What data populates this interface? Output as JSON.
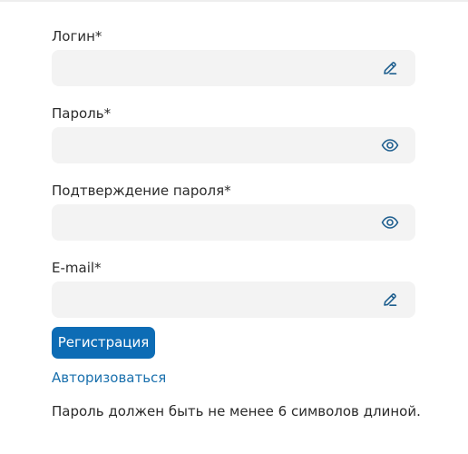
{
  "fields": [
    {
      "label": "Логин*",
      "value": "",
      "placeholder": "",
      "icon": "pencil-icon"
    },
    {
      "label": "Пароль*",
      "value": "",
      "placeholder": "",
      "icon": "eye-icon"
    },
    {
      "label": "Подтверждение пароля*",
      "value": "",
      "placeholder": "",
      "icon": "eye-icon"
    },
    {
      "label": "E-mail*",
      "value": "",
      "placeholder": "",
      "icon": "pencil-icon"
    }
  ],
  "actions": {
    "register_label": "Регистрация",
    "login_link": "Авторизоваться"
  },
  "hint": "Пароль должен быть не менее 6 символов длиной.",
  "colors": {
    "accent": "#0d6cb5",
    "link": "#1a70ad",
    "field_bg": "#f3f3f3",
    "icon": "#1f5f8f",
    "text": "#2b2b2b"
  }
}
